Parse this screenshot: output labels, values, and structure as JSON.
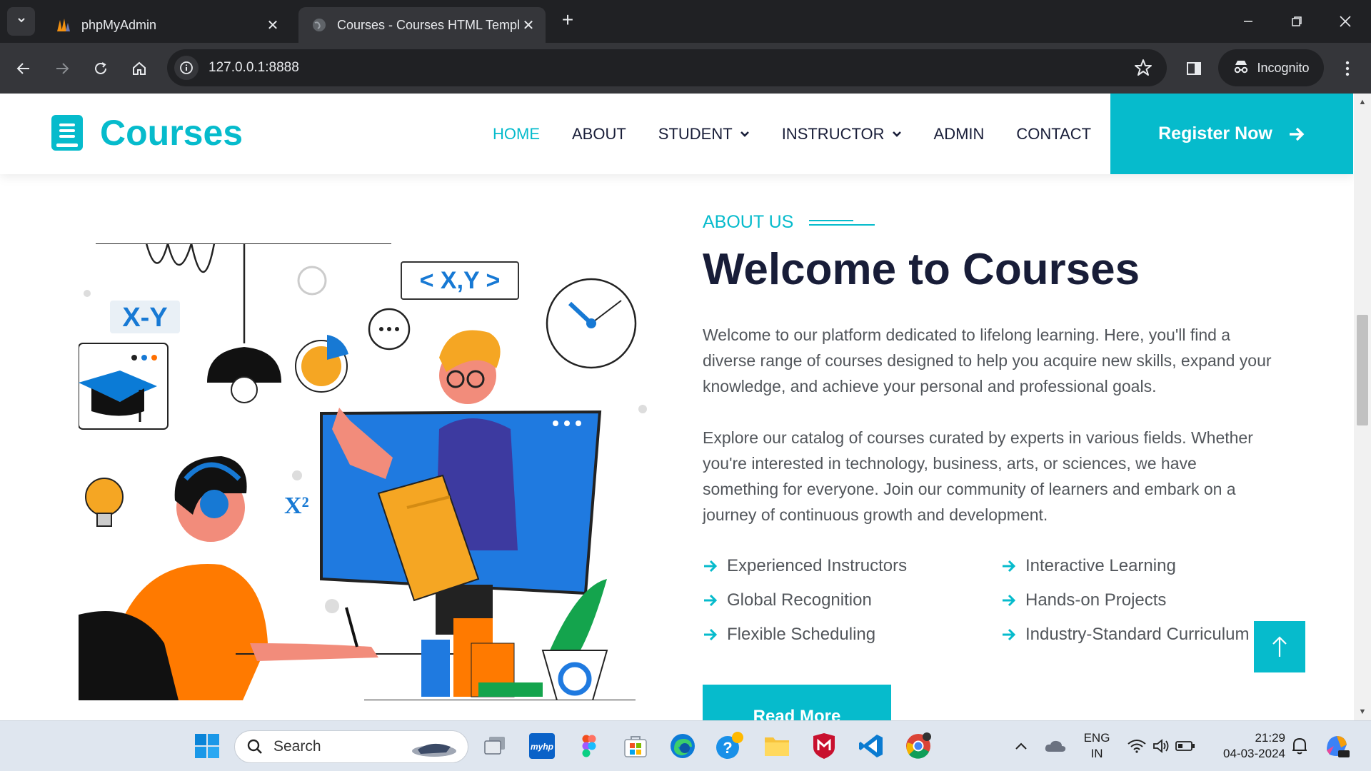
{
  "browser": {
    "tabs": [
      {
        "title": "phpMyAdmin",
        "active": false
      },
      {
        "title": "Courses - Courses HTML Templ",
        "active": true
      }
    ],
    "url": "127.0.0.1:8888",
    "incognito_label": "Incognito"
  },
  "site": {
    "brand": "Courses",
    "nav": [
      {
        "label": "HOME",
        "active": true,
        "dropdown": false
      },
      {
        "label": "ABOUT",
        "active": false,
        "dropdown": false
      },
      {
        "label": "STUDENT",
        "active": false,
        "dropdown": true
      },
      {
        "label": "INSTRUCTOR",
        "active": false,
        "dropdown": true
      },
      {
        "label": "ADMIN",
        "active": false,
        "dropdown": false
      },
      {
        "label": "CONTACT",
        "active": false,
        "dropdown": false
      }
    ],
    "register_label": "Register Now",
    "accent_color": "#06bbcc",
    "dark_color": "#181d38"
  },
  "about": {
    "eyebrow": "ABOUT US",
    "heading": "Welcome to Courses",
    "paragraphs": [
      "Welcome to our platform dedicated to lifelong learning. Here, you'll find a diverse range of courses designed to help you acquire new skills, expand your knowledge, and achieve your personal and professional goals.",
      "Explore our catalog of courses curated by experts in various fields. Whether you're interested in technology, business, arts, or sciences, we have something for everyone. Join our community of learners and embark on a journey of continuous growth and development."
    ],
    "features": [
      "Experienced Instructors",
      "Interactive Learning",
      "Global Recognition",
      "Hands-on Projects",
      "Flexible Scheduling",
      "Industry-Standard Curriculum"
    ],
    "read_more": "Read More"
  },
  "illustration": {
    "labels": [
      "X-Y",
      "< X,Y >",
      "X²"
    ]
  },
  "taskbar": {
    "search_placeholder": "Search",
    "language": "ENG",
    "region": "IN",
    "time": "21:29",
    "date": "04-03-2024",
    "myhp_label": "myhp"
  }
}
